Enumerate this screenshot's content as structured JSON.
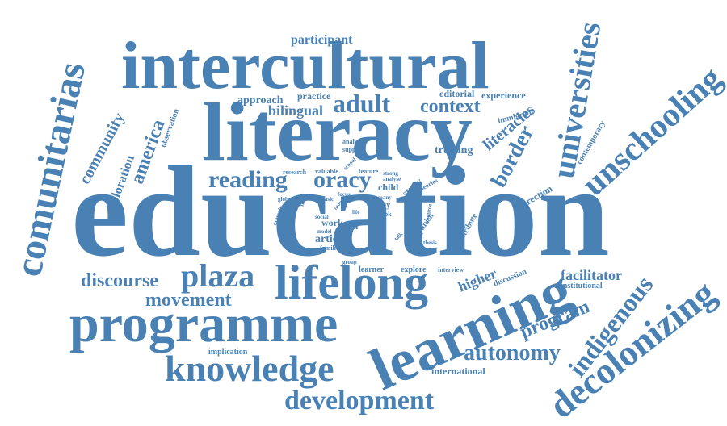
{
  "color": "#4a81b4",
  "words": [
    "education",
    "literacy",
    "intercultural",
    "learning",
    "programme",
    "comunitarias",
    "universities",
    "unschooling",
    "lifelong",
    "knowledge",
    "decolonizing",
    "development",
    "plaza",
    "adult",
    "reading",
    "oracy",
    "indigenous",
    "context",
    "autonomy",
    "border",
    "movement",
    "discourse",
    "bilingual",
    "america",
    "program",
    "community",
    "exploration",
    "literacies",
    "participant",
    "approach",
    "practice",
    "editorial",
    "experience",
    "facilitator",
    "higher",
    "trusting",
    "article",
    "latin",
    "work",
    "immigrant",
    "observation",
    "contemporary",
    "direction",
    "study",
    "spanish",
    "institutional",
    "international",
    "implication",
    "discussion",
    "learner",
    "explore",
    "interview",
    "families",
    "theories",
    "child",
    "contribute",
    "analysis",
    "support",
    "research",
    "valuable",
    "feature",
    "strong",
    "school",
    "analyse",
    "need",
    "global",
    "basic",
    "focus",
    "life",
    "way",
    "look",
    "many",
    "more",
    "social",
    "example",
    "model",
    "provide",
    "resource",
    "thesis",
    "society",
    "group",
    "talk"
  ]
}
